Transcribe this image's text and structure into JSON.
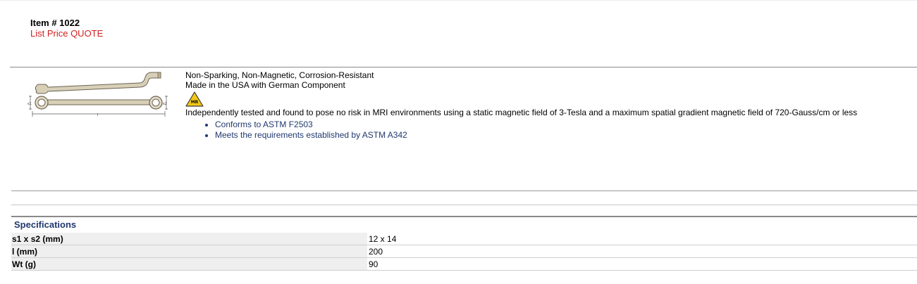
{
  "item": {
    "number": "Item # 1022",
    "list_price": "List Price QUOTE"
  },
  "description": {
    "lines": [
      "Non-Sparking, Non-Magnetic, Corrosion-Resistant",
      "Made in the USA with German Component"
    ],
    "mri_icon_label": "MR",
    "mri_text": "Independently tested and found to pose no risk in MRI environments using a static magnetic field of 3-Tesla and a maximum spatial gradient magnetic field of 720-Gauss/cm or less",
    "bullets": [
      "Conforms to ASTM F2503",
      "Meets the requirements established by ASTM A342"
    ]
  },
  "product_image": {
    "dim_labels": {
      "s1": "s1",
      "s2": "s2",
      "l": "l"
    }
  },
  "specifications": {
    "title": "Specifications",
    "rows": [
      {
        "label": "s1 x s2 (mm)",
        "value": "12 x 14"
      },
      {
        "label": "l (mm)",
        "value": "200"
      },
      {
        "label": "Wt (g)",
        "value": "90"
      }
    ]
  },
  "colors": {
    "price_red": "#d21f1f",
    "link_blue": "#20386e",
    "mri_yellow": "#f2c811"
  }
}
